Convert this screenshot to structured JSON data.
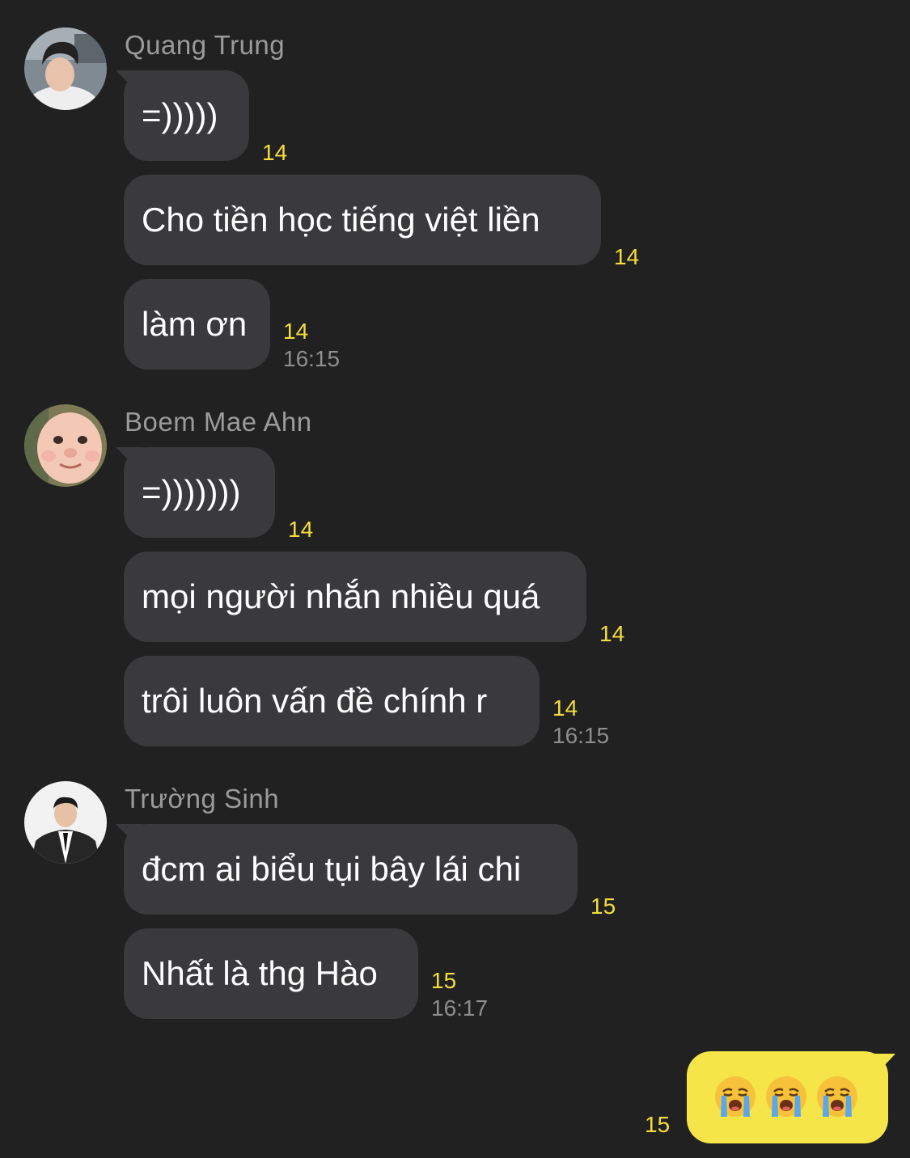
{
  "chat": {
    "groups": [
      {
        "sender": "Quang Trung",
        "avatar_icon": "person-selfie-avatar",
        "messages": [
          {
            "text": "=)))))",
            "count": "14",
            "time": ""
          },
          {
            "text": "Cho tiền học tiếng việt liền",
            "count": "14",
            "time": ""
          },
          {
            "text": "làm ơn",
            "count": "14",
            "time": "16:15"
          }
        ]
      },
      {
        "sender": "Boem Mae Ahn",
        "avatar_icon": "baby-face-avatar",
        "messages": [
          {
            "text": "=)))))))",
            "count": "14",
            "time": ""
          },
          {
            "text": "mọi người nhắn nhiều quá",
            "count": "14",
            "time": ""
          },
          {
            "text": "trôi luôn vấn đề chính r",
            "count": "14",
            "time": "16:15"
          }
        ]
      },
      {
        "sender": "Trường Sinh",
        "avatar_icon": "man-in-suit-avatar",
        "messages": [
          {
            "text": "đcm ai biểu tụi bây lái chi",
            "count": "15",
            "time": ""
          },
          {
            "text": "Nhất là thg Hào",
            "count": "15",
            "time": "16:17"
          }
        ]
      }
    ],
    "outgoing": {
      "emojis": [
        "crying-face-emoji",
        "crying-face-emoji",
        "crying-face-emoji"
      ],
      "count": "15"
    }
  },
  "colors": {
    "background": "#212121",
    "incoming_bubble": "#3a3a3c",
    "outgoing_bubble": "#f6e548",
    "unread_count": "#f4dd3c",
    "timestamp": "#8e8e8e",
    "sender_name": "#9b9b9b"
  }
}
